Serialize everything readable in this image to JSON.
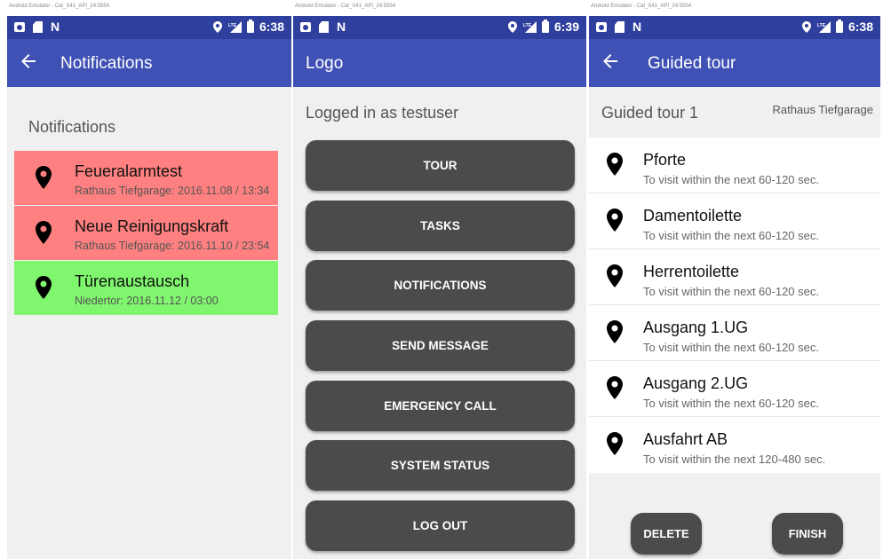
{
  "emulator_title": "Android Emulator - Cat_S41_API_24:5554",
  "status": {
    "time1": "6:38",
    "time2": "6:39",
    "time3": "6:38"
  },
  "colors": {
    "statusbar": "#2f3f9e",
    "appbar": "#3f51b5",
    "notif_red": "#ff8080",
    "notif_green": "#80f56e",
    "button": "#4b4b4b"
  },
  "icons": {
    "back": "arrow-left-icon",
    "location": "map-pin-icon"
  },
  "screen1": {
    "title": "Notifications",
    "heading": "Notifications",
    "items": [
      {
        "title": "Feueralarmtest",
        "subtitle": "Rathaus Tiefgarage: 2016.11.08 / 13:34",
        "color": "#ff8080"
      },
      {
        "title": "Neue Reinigungskraft",
        "subtitle": "Rathaus Tiefgarage: 2016.11.10 / 23:54",
        "color": "#ff8080"
      },
      {
        "title": "Türenaustausch",
        "subtitle": "Niedertor: 2016.11.12 / 03:00",
        "color": "#80f56e"
      }
    ]
  },
  "screen2": {
    "title": "Logo",
    "logged_in": "Logged in as testuser",
    "buttons": [
      "TOUR",
      "TASKS",
      "NOTIFICATIONS",
      "SEND MESSAGE",
      "EMERGENCY CALL",
      "SYSTEM STATUS",
      "LOG OUT"
    ]
  },
  "screen3": {
    "title": "Guided tour",
    "tour_name": "Guided tour 1",
    "location": "Rathaus Tiefgarage",
    "items": [
      {
        "title": "Pforte",
        "subtitle": "To visit within the next 60-120 sec."
      },
      {
        "title": "Damentoilette",
        "subtitle": "To visit within the next 60-120 sec."
      },
      {
        "title": "Herrentoilette",
        "subtitle": "To visit within the next 60-120 sec."
      },
      {
        "title": "Ausgang 1.UG",
        "subtitle": "To visit within the next 60-120 sec."
      },
      {
        "title": "Ausgang 2.UG",
        "subtitle": "To visit within the next 60-120 sec."
      },
      {
        "title": "Ausfahrt AB",
        "subtitle": "To visit within the next 120-480 sec."
      }
    ],
    "delete_label": "DELETE",
    "finish_label": "FINISH"
  }
}
